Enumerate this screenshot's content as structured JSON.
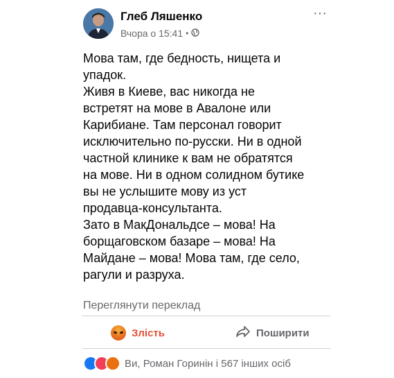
{
  "post": {
    "author": "Глеб Ляшенко",
    "timestamp": "Вчора о 15:41",
    "privacy_icon": "globe-icon",
    "more_icon": "more-horizontal-icon",
    "text_lines": [
      "Мова там, где бедность, нищета и",
      "упадок.",
      "Живя в Киеве, вас никогда не",
      "встретят на мове в Авалоне или",
      "Карибиане. Там персонал говорит",
      "исключительно по-русски. Ни в одной",
      "частной клинике к вам не обратятся",
      "на мове. Ни в одном солидном бутике",
      "вы не услышите мову из уст",
      "продавца-консультанта.",
      "Зато в МакДональдсе – мова! На",
      "борщаговском базаре – мова! На",
      "Майдане – мова! Мова там, где село,",
      "рагули и разруха."
    ],
    "translate_label": "Переглянути переклад"
  },
  "actions": {
    "react_label": "Злість",
    "react_icon": "angry-reaction-icon",
    "share_label": "Поширити",
    "share_icon": "share-arrow-icon"
  },
  "reactions_summary": {
    "icons": [
      "like-reaction-icon",
      "love-reaction-icon",
      "angry-reaction-icon"
    ],
    "text": "Ви, Роман Горинін і 567 інших осіб"
  },
  "colors": {
    "angry": "#e4523a",
    "secondary_text": "#65676b",
    "like": "#1877f2",
    "love": "#f33e58"
  }
}
